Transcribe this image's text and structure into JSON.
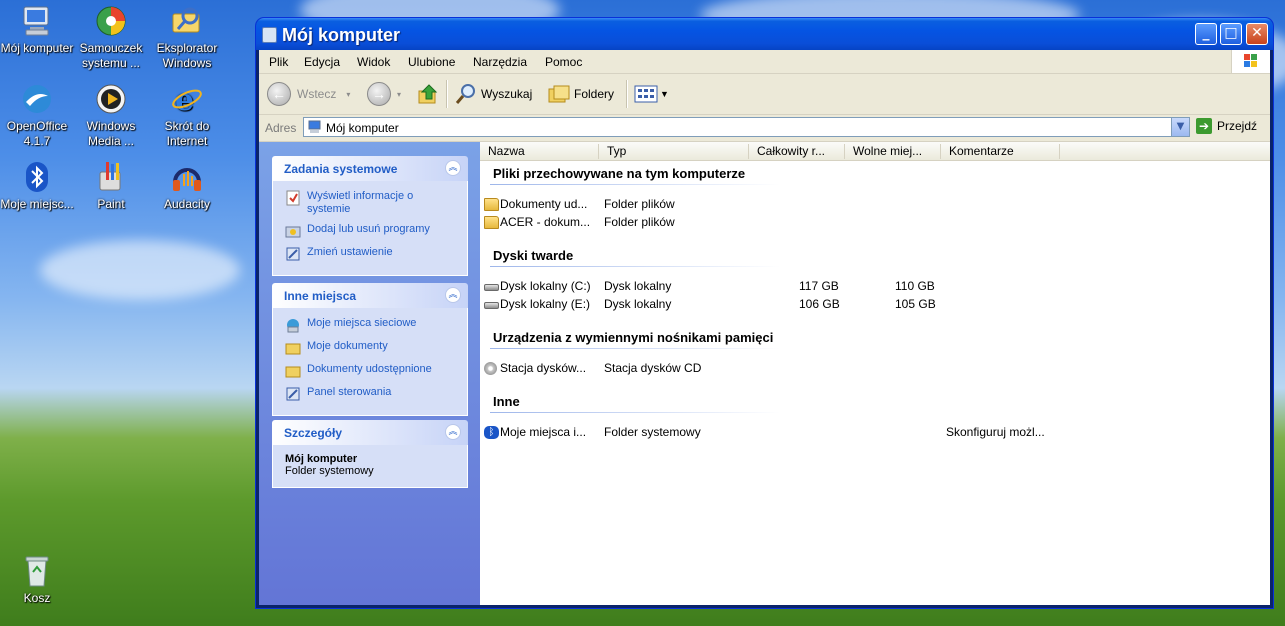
{
  "desktop": {
    "icons": [
      {
        "label": "Mój komputer",
        "icon": "my-computer-icon"
      },
      {
        "label": "Samouczek systemu ...",
        "icon": "tutorial-icon"
      },
      {
        "label": "Eksplorator Windows",
        "icon": "explorer-icon"
      },
      {
        "label": "OpenOffice 4.1.7",
        "icon": "openoffice-icon"
      },
      {
        "label": "Windows Media ...",
        "icon": "media-player-icon"
      },
      {
        "label": "Skrót do Internet",
        "icon": "internet-explorer-icon"
      },
      {
        "label": "Moje miejsc...",
        "icon": "bluetooth-icon"
      },
      {
        "label": "Paint",
        "icon": "paint-icon"
      },
      {
        "label": "Audacity",
        "icon": "audacity-icon"
      },
      {
        "label": "Kosz",
        "icon": "recycle-bin-icon"
      }
    ]
  },
  "window": {
    "title": "Mój komputer",
    "buttons": {
      "minimize": "_",
      "maximize": "□",
      "close": "✕"
    }
  },
  "menu": [
    "Plik",
    "Edycja",
    "Widok",
    "Ulubione",
    "Narzędzia",
    "Pomoc"
  ],
  "toolbar": {
    "back": "Wstecz",
    "search": "Wyszukaj",
    "folders": "Foldery"
  },
  "address": {
    "label": "Adres",
    "value": "Mój komputer",
    "go": "Przejdź"
  },
  "taskpane": {
    "system": {
      "title": "Zadania systemowe",
      "items": [
        "Wyświetl informacje o systemie",
        "Dodaj lub usuń programy",
        "Zmień ustawienie"
      ]
    },
    "places": {
      "title": "Inne miejsca",
      "items": [
        "Moje miejsca sieciowe",
        "Moje dokumenty",
        "Dokumenty udostępnione",
        "Panel sterowania"
      ]
    },
    "details": {
      "title": "Szczegóły",
      "name": "Mój komputer",
      "type": "Folder systemowy"
    }
  },
  "columns": [
    "Nazwa",
    "Typ",
    "Całkowity r...",
    "Wolne miej...",
    "Komentarze"
  ],
  "groups": [
    {
      "title": "Pliki przechowywane na tym komputerze",
      "rows": [
        {
          "name": "Dokumenty ud...",
          "type": "Folder plików",
          "total": "",
          "free": "",
          "comment": "",
          "icon": "folder-icon"
        },
        {
          "name": "ACER - dokum...",
          "type": "Folder plików",
          "total": "",
          "free": "",
          "comment": "",
          "icon": "folder-icon"
        }
      ]
    },
    {
      "title": "Dyski twarde",
      "rows": [
        {
          "name": "Dysk lokalny (C:)",
          "type": "Dysk lokalny",
          "total": "117 GB",
          "free": "110 GB",
          "comment": "",
          "icon": "hard-drive-icon"
        },
        {
          "name": "Dysk lokalny (E:)",
          "type": "Dysk lokalny",
          "total": "106 GB",
          "free": "105 GB",
          "comment": "",
          "icon": "hard-drive-icon"
        }
      ]
    },
    {
      "title": "Urządzenia z wymiennymi nośnikami pamięci",
      "rows": [
        {
          "name": "Stacja dysków...",
          "type": "Stacja dysków CD",
          "total": "",
          "free": "",
          "comment": "",
          "icon": "cd-drive-icon"
        }
      ]
    },
    {
      "title": "Inne",
      "rows": [
        {
          "name": "Moje miejsca i...",
          "type": "Folder systemowy",
          "total": "",
          "free": "",
          "comment": "Skonfiguruj możl...",
          "icon": "bluetooth-icon"
        }
      ]
    }
  ]
}
